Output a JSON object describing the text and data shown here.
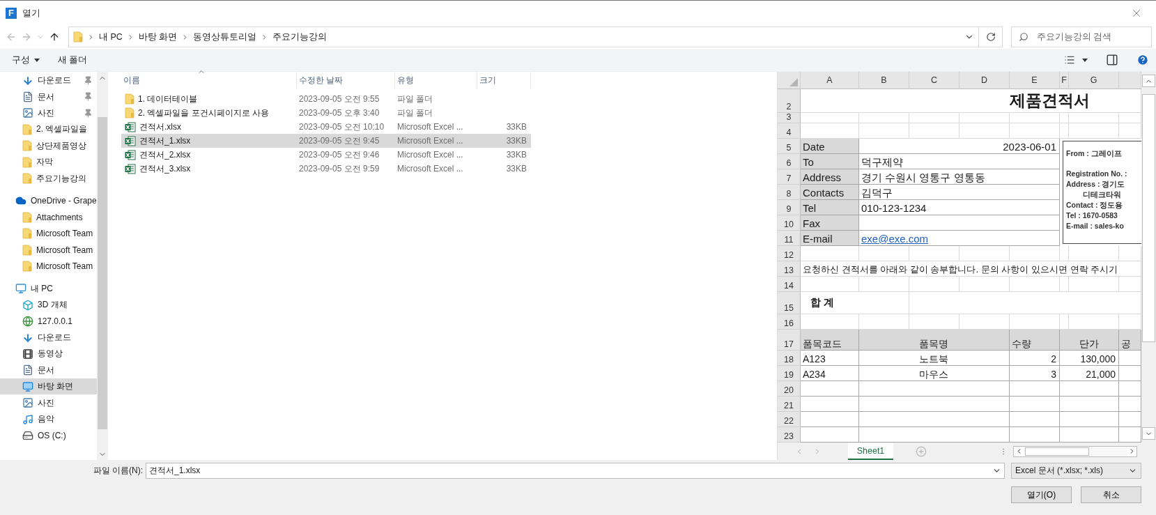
{
  "window": {
    "icon_letter": "F",
    "title": "열기"
  },
  "address": {
    "path": [
      "내 PC",
      "바탕 화면",
      "동영상튜토리얼",
      "주요기능강의"
    ]
  },
  "search": {
    "placeholder": "주요기능강의 검색"
  },
  "toolbar": {
    "organize": "구성",
    "new_folder": "새 폴더"
  },
  "sidebar": {
    "groups": [
      {
        "items": [
          {
            "kind": "download",
            "label": "다운로드",
            "pinned": true,
            "selected": false
          },
          {
            "kind": "document",
            "label": "문서",
            "pinned": true,
            "selected": false
          },
          {
            "kind": "picture",
            "label": "사진",
            "pinned": true,
            "selected": false
          },
          {
            "kind": "folder",
            "label": "2. 엑셀파일을",
            "pinned": false,
            "selected": false
          },
          {
            "kind": "folder",
            "label": "상단제품영상",
            "pinned": false,
            "selected": false
          },
          {
            "kind": "folder",
            "label": "자막",
            "pinned": false,
            "selected": false
          },
          {
            "kind": "folder",
            "label": "주요기능강의",
            "pinned": false,
            "selected": false
          }
        ]
      },
      {
        "head": {
          "kind": "cloud",
          "label": "OneDrive - Grape",
          "selected": false
        },
        "items": [
          {
            "kind": "folder",
            "label": "Attachments",
            "selected": false
          },
          {
            "kind": "folder",
            "label": "Microsoft Team",
            "selected": false
          },
          {
            "kind": "folder",
            "label": "Microsoft Team",
            "selected": false
          },
          {
            "kind": "folder",
            "label": "Microsoft Team",
            "selected": false
          }
        ]
      },
      {
        "head": {
          "kind": "pc",
          "label": "내 PC",
          "selected": false
        },
        "items": [
          {
            "kind": "objects3d",
            "label": "3D 개체",
            "selected": false
          },
          {
            "kind": "network",
            "label": "127.0.0.1",
            "selected": false
          },
          {
            "kind": "download",
            "label": "다운로드",
            "selected": false
          },
          {
            "kind": "video",
            "label": "동영상",
            "selected": false
          },
          {
            "kind": "document",
            "label": "문서",
            "selected": false
          },
          {
            "kind": "desktop",
            "label": "바탕 화면",
            "selected": true
          },
          {
            "kind": "picture",
            "label": "사진",
            "selected": false
          },
          {
            "kind": "music",
            "label": "음악",
            "selected": false
          },
          {
            "kind": "drive",
            "label": "OS (C:)",
            "selected": false
          }
        ]
      }
    ]
  },
  "file_list": {
    "columns": [
      "이름",
      "수정한 날짜",
      "유형",
      "크기"
    ],
    "rows": [
      {
        "kind": "folder",
        "name": "1. 데이터테이블",
        "modified": "2023-09-05 오전 9:55",
        "type": "파일 폴더",
        "selected": false
      },
      {
        "kind": "folder",
        "name": "2. 엑셀파일을 포건시페이지로 사용",
        "modified": "2023-09-05 오후 3:40",
        "type": "파일 폴더",
        "selected": false
      },
      {
        "kind": "excel",
        "name": "견적서.xlsx",
        "modified": "2023-09-05 오전 10:10",
        "type": "Microsoft Excel ...",
        "size": "33KB",
        "selected": false
      },
      {
        "kind": "excel",
        "name": "견적서_1.xlsx",
        "modified": "2023-09-05 오전 9:45",
        "type": "Microsoft Excel ...",
        "size": "33KB",
        "selected": true
      },
      {
        "kind": "excel",
        "name": "견적서_2.xlsx",
        "modified": "2023-09-05 오전 9:46",
        "type": "Microsoft Excel ...",
        "size": "33KB",
        "selected": false
      },
      {
        "kind": "excel",
        "name": "견적서_3.xlsx",
        "modified": "2023-09-05 오전 9:59",
        "type": "Microsoft Excel ...",
        "size": "33KB",
        "selected": false
      }
    ]
  },
  "preview": {
    "columns": [
      "A",
      "B",
      "C",
      "D",
      "E",
      "F",
      "G"
    ],
    "rows": [
      {
        "kind": "title",
        "number": "2",
        "text": "제품견적서"
      },
      {
        "kind": "thin",
        "number": "3"
      },
      {
        "kind": "blank",
        "number": "4"
      },
      {
        "kind": "date_field",
        "number": "5",
        "label": "Date",
        "date": "2023-06-01"
      },
      {
        "kind": "field",
        "number": "6",
        "label": "To",
        "value": "덕구제약"
      },
      {
        "kind": "field",
        "number": "7",
        "label": "Address",
        "value": "경기 수원시 영통구 영통동"
      },
      {
        "kind": "field",
        "number": "8",
        "label": "Contacts",
        "value": "김덕구"
      },
      {
        "kind": "field",
        "number": "9",
        "label": "Tel",
        "value": "010-123-1234"
      },
      {
        "kind": "field",
        "number": "10",
        "label": "Fax"
      },
      {
        "kind": "field",
        "number": "11",
        "label": "E-mail",
        "value": "exe@exe.com",
        "link": true
      },
      {
        "kind": "blank",
        "number": "12"
      },
      {
        "kind": "note",
        "number": "13",
        "text": "요청하신 견적서를 아래와 같이 송부합니다. 문의 사항이 있으시면 연락 주시기"
      },
      {
        "kind": "blank",
        "number": "14"
      },
      {
        "kind": "total",
        "number": "15",
        "label": "합 계"
      },
      {
        "kind": "blank",
        "number": "16"
      },
      {
        "kind": "header",
        "number": "17",
        "cells": [
          "품목코드",
          "품목명",
          "수량",
          "단가",
          "공"
        ]
      },
      {
        "kind": "item",
        "number": "18",
        "cells": [
          "A123",
          "노트북",
          "2",
          "130,000"
        ]
      },
      {
        "kind": "item",
        "number": "19",
        "cells": [
          "A234",
          "마우스",
          "3",
          "21,000"
        ]
      },
      {
        "kind": "item",
        "number": "20"
      },
      {
        "kind": "item",
        "number": "21"
      },
      {
        "kind": "item",
        "number": "22"
      },
      {
        "kind": "item",
        "number": "23"
      }
    ],
    "info_box": {
      "lines": [
        "From : 그레이프",
        "Registration No. :",
        "Address : 경기도",
        "디테크타워",
        "Contact : 정도용",
        "Tel : 1670-0583",
        "E-mail : sales-ko"
      ]
    },
    "sheet_tabs": [
      {
        "label": "Sheet1",
        "selected": true
      }
    ]
  },
  "footer": {
    "filename_label": "파일 이름(N):",
    "filename": "견적서_1.xlsx",
    "filter": "Excel 문서 (*.xlsx; *.xls)",
    "open": "열기(O)",
    "cancel": "취소"
  }
}
